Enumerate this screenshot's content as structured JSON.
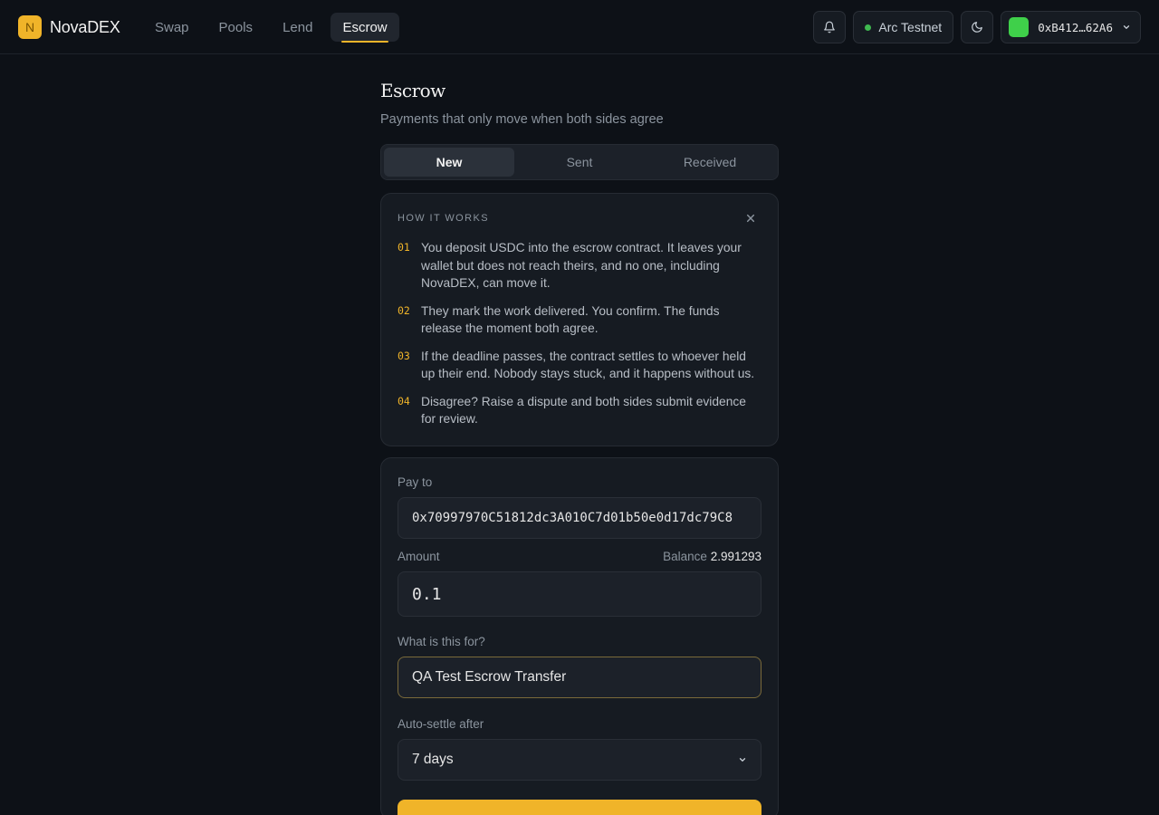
{
  "brand": {
    "logo_letter": "N",
    "name": "NovaDEX",
    "accent": "#f0b429"
  },
  "nav": [
    {
      "label": "Swap"
    },
    {
      "label": "Pools"
    },
    {
      "label": "Lend"
    },
    {
      "label": "Escrow",
      "active": true
    }
  ],
  "header_tools": {
    "network": "Arc Testnet",
    "wallet_address": "0xB412…62A6",
    "icons": [
      "bell-icon",
      "moon-icon",
      "chevron-down-icon"
    ]
  },
  "page": {
    "title": "Escrow",
    "subtitle": "Payments that only move when both sides agree"
  },
  "tabs": [
    {
      "label": "New",
      "active": true
    },
    {
      "label": "Sent"
    },
    {
      "label": "Received"
    }
  ],
  "how_it_works": {
    "title": "HOW IT WORKS",
    "steps": [
      {
        "num": "01",
        "text": "You deposit USDC into the escrow contract. It leaves your wallet but does not reach theirs, and no one, including NovaDEX, can move it."
      },
      {
        "num": "02",
        "text": "They mark the work delivered. You confirm. The funds release the moment both agree."
      },
      {
        "num": "03",
        "text": "If the deadline passes, the contract settles to whoever held up their end. Nobody stays stuck, and it happens without us."
      },
      {
        "num": "04",
        "text": "Disagree? Raise a dispute and both sides submit evidence for review."
      }
    ]
  },
  "form": {
    "pay_to_label": "Pay to",
    "pay_to_value": "0x70997970C51812dc3A010C7d01b50e0d17dc79C8",
    "amount_label": "Amount",
    "balance_label": "Balance",
    "balance_value": "2.991293",
    "amount_value": "0.1",
    "purpose_label": "What is this for?",
    "purpose_value": "QA Test Escrow Transfer",
    "autosettle_label": "Auto-settle after",
    "autosettle_value": "7 days"
  }
}
